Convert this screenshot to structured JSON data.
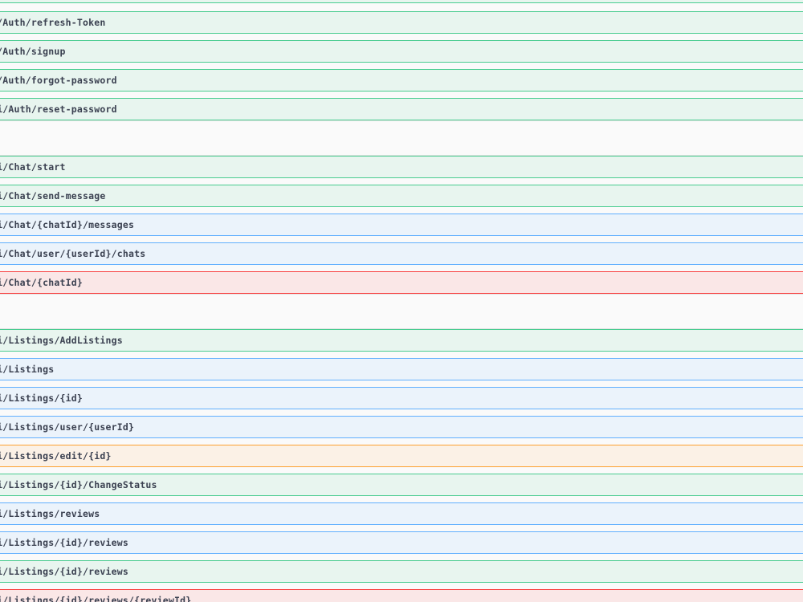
{
  "colors": {
    "post_bg": "#e8f5ef",
    "post_border": "#49cc90",
    "get_bg": "#ebf3fb",
    "get_border": "#61affe",
    "put_bg": "#fbf1e6",
    "put_border": "#fca130",
    "delete_bg": "#fae7e7",
    "delete_border": "#f93e3e",
    "text": "#3b4151"
  },
  "operations": {
    "auth_refresh_token": {
      "path": "i/Auth/refresh-Token",
      "method": "post"
    },
    "auth_signup": {
      "path": "i/Auth/signup",
      "method": "post"
    },
    "auth_forgot_password": {
      "path": "i/Auth/forgot-password",
      "method": "post"
    },
    "auth_reset_password": {
      "path": "pi/Auth/reset-password",
      "method": "post"
    },
    "chat_start": {
      "path": "pi/Chat/start",
      "method": "post"
    },
    "chat_send_message": {
      "path": "pi/Chat/send-message",
      "method": "post"
    },
    "chat_messages": {
      "path": "pi/Chat/{chatId}/messages",
      "method": "get"
    },
    "chat_user_chats": {
      "path": "pi/Chat/user/{userId}/chats",
      "method": "get"
    },
    "chat_delete": {
      "path": "pi/Chat/{chatId}",
      "method": "delete"
    },
    "listings_add": {
      "path": "pi/Listings/AddListings",
      "method": "post"
    },
    "listings_all": {
      "path": "pi/Listings",
      "method": "get"
    },
    "listings_by_id": {
      "path": "pi/Listings/{id}",
      "method": "get"
    },
    "listings_by_user": {
      "path": "pi/Listings/user/{userId}",
      "method": "get"
    },
    "listings_edit": {
      "path": "pi/Listings/edit/{id}",
      "method": "put"
    },
    "listings_change_status": {
      "path": "pi/Listings/{id}/ChangeStatus",
      "method": "post"
    },
    "listings_reviews": {
      "path": "pi/Listings/reviews",
      "method": "get"
    },
    "listings_id_reviews_get": {
      "path": "pi/Listings/{id}/reviews",
      "method": "get"
    },
    "listings_id_reviews_post": {
      "path": "pi/Listings/{id}/reviews",
      "method": "post"
    },
    "listings_review_delete": {
      "path": "pi/Listings/{id}/reviews/{reviewId}",
      "method": "delete"
    }
  }
}
